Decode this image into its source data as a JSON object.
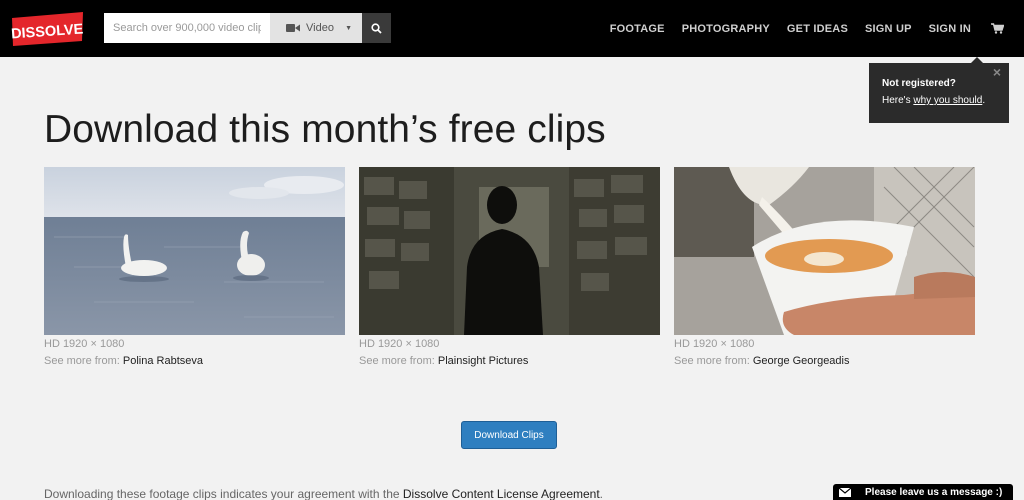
{
  "header": {
    "logo_text": "DISSOLVE",
    "search": {
      "placeholder": "Search over 900,000 video clips",
      "value": ""
    },
    "type_select": {
      "selected": "Video",
      "icon": "video-camera-icon"
    },
    "search_button_icon": "search-icon",
    "nav": [
      {
        "label": "FOOTAGE"
      },
      {
        "label": "PHOTOGRAPHY"
      },
      {
        "label": "GET IDEAS"
      },
      {
        "label": "SIGN UP"
      },
      {
        "label": "SIGN IN"
      }
    ],
    "cart_icon": "cart-icon"
  },
  "tooltip": {
    "heading": "Not registered?",
    "prefix": "Here's ",
    "link": "why you should",
    "suffix": ".",
    "close": "×"
  },
  "main": {
    "title": "Download this month’s free clips",
    "clips": [
      {
        "resolution": "HD 1920 × 1080",
        "more_label": "See more from:",
        "author": "Polina Rabtseva",
        "image": "swans-on-water"
      },
      {
        "resolution": "HD 1920 × 1080",
        "more_label": "See more from:",
        "author": "Plainsight Pictures",
        "image": "silhouette-in-archive"
      },
      {
        "resolution": "HD 1920 × 1080",
        "more_label": "See more from:",
        "author": "George Georgeadis",
        "image": "milk-pouring-into-coffee"
      }
    ],
    "download_button": "Download Clips",
    "agreement_prefix": "Downloading these footage clips indicates your agreement with the ",
    "agreement_link": "Dissolve Content License Agreement",
    "agreement_suffix": "."
  },
  "chat": {
    "label": "Please leave us a message :)",
    "icon": "envelope-icon"
  },
  "colors": {
    "header_bg": "#000000",
    "logo_red": "#e4262b",
    "button_blue": "#2f7fc0",
    "page_bg": "#f2f2f2"
  }
}
